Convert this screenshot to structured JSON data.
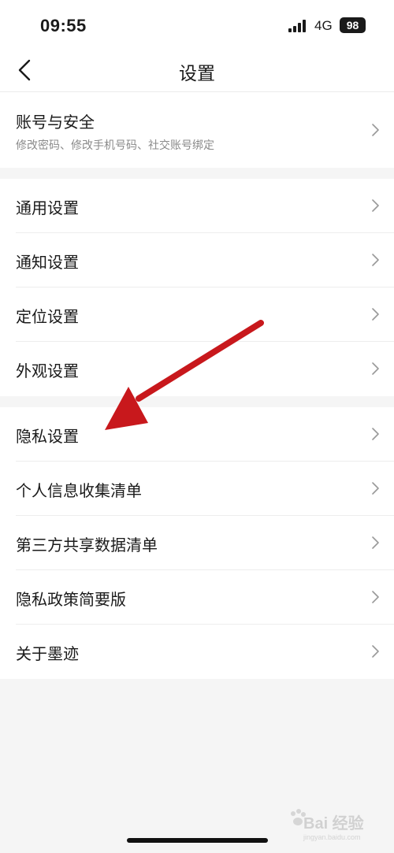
{
  "status": {
    "time": "09:55",
    "network": "4G",
    "battery": "98"
  },
  "nav": {
    "title": "设置",
    "back_icon": "chevron-left-icon"
  },
  "account": {
    "title": "账号与安全",
    "subtitle": "修改密码、修改手机号码、社交账号绑定"
  },
  "group_general": {
    "items": [
      {
        "label": "通用设置"
      },
      {
        "label": "通知设置"
      },
      {
        "label": "定位设置"
      },
      {
        "label": "外观设置"
      }
    ]
  },
  "group_privacy": {
    "items": [
      {
        "label": "隐私设置"
      },
      {
        "label": "个人信息收集清单"
      },
      {
        "label": "第三方共享数据清单"
      },
      {
        "label": "隐私政策简要版"
      },
      {
        "label": "关于墨迹"
      }
    ]
  },
  "watermark": {
    "text": "Bai 经验",
    "sub": "jingyan.baidu.com"
  },
  "colors": {
    "annotation_arrow": "#c8181c",
    "background": "#f5f5f5",
    "card": "#ffffff"
  }
}
